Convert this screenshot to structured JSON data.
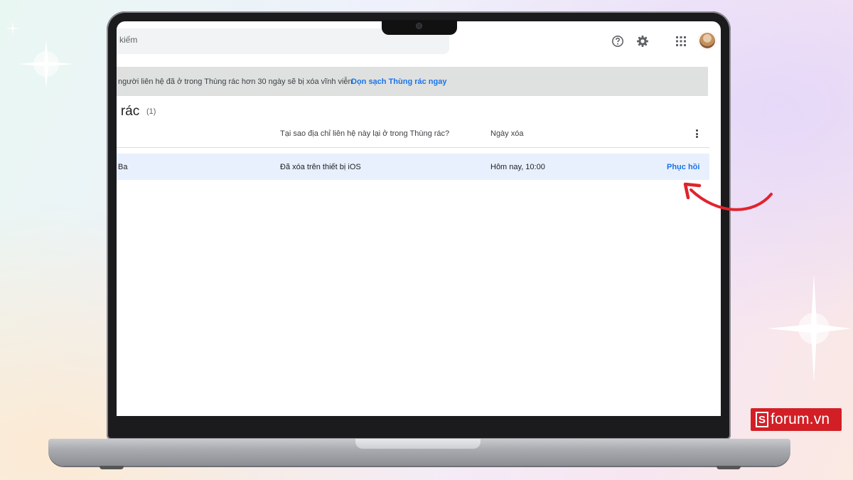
{
  "search": {
    "placeholder": "kiếm"
  },
  "topbar": {
    "icons": [
      "help-icon",
      "settings-icon",
      "apps-icon",
      "avatar"
    ]
  },
  "banner": {
    "text": "người liên hệ đã ở trong Thùng rác hơn 30 ngày sẽ bị xóa vĩnh viễn",
    "link": "Dọn sạch Thùng rác ngay"
  },
  "trash": {
    "title": "g rác",
    "count": "(1)"
  },
  "table": {
    "headers": [
      "Tại sao địa chỉ liên hệ này lại ở trong Thùng rác?",
      "Ngày xóa"
    ],
    "rows": [
      {
        "name": "Ba",
        "reason": "Đã xóa trên thiết bị iOS",
        "date": "Hôm nay, 10:00",
        "action": "Phục hồi"
      }
    ]
  },
  "watermark": {
    "text": "forum.vn",
    "mark": "S"
  },
  "colors": {
    "link": "#1a73e8",
    "banner_bg": "#dfe1e0",
    "row_bg": "#e8f0fe",
    "arrow": "#e0242e",
    "brand": "#d21f26"
  }
}
